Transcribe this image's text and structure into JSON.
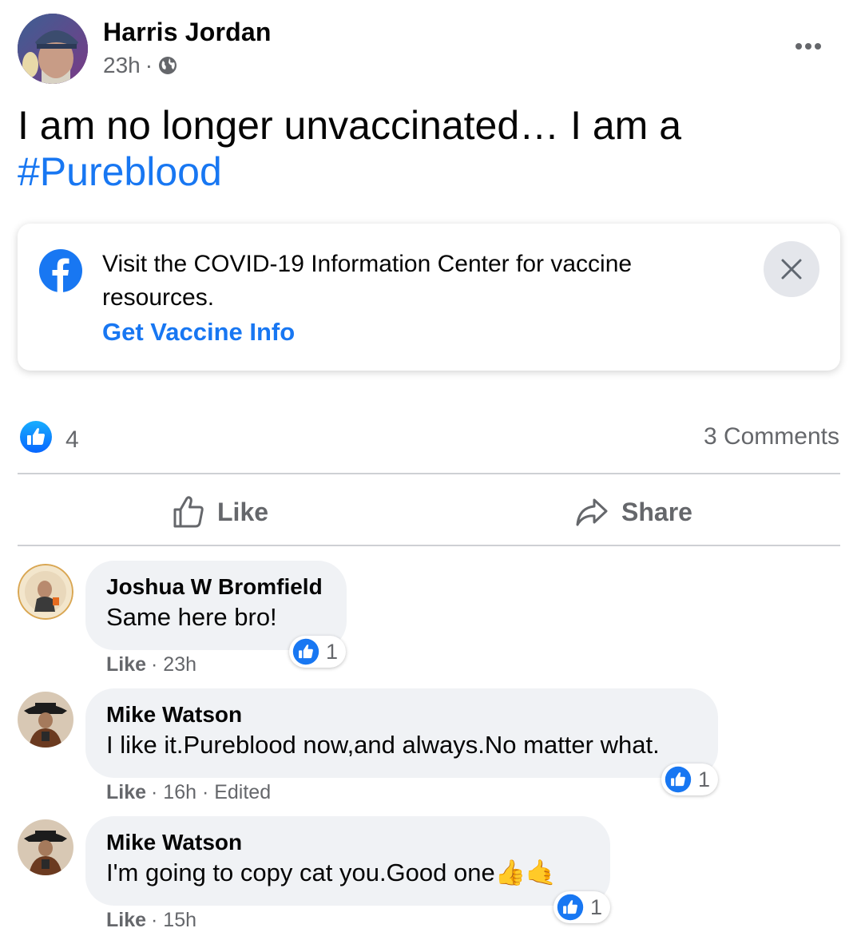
{
  "post": {
    "author": "Harris Jordan",
    "time": "23h",
    "separator": "·",
    "text": "I am no longer unvaccinated… I am a",
    "hashtag": "#Pureblood"
  },
  "info_card": {
    "text": "Visit the COVID-19 Information Center for vaccine resources.",
    "link": "Get Vaccine Info"
  },
  "summary": {
    "reaction_count": "4",
    "comments": "3 Comments"
  },
  "actions": {
    "like": "Like",
    "share": "Share"
  },
  "comments": [
    {
      "name": "Joshua W Bromfield",
      "text": "Same here bro!",
      "reactions": "1",
      "like": "Like",
      "meta": "· 23h"
    },
    {
      "name": "Mike Watson",
      "text": "I like it.Pureblood now,and always.No matter what.",
      "reactions": "1",
      "like": "Like",
      "meta": "· 16h · Edited"
    },
    {
      "name": "Mike Watson",
      "text": "I'm going to copy cat you.Good one",
      "emoji": "👍🤙",
      "reactions": "1",
      "like": "Like",
      "meta": "· 15h"
    }
  ],
  "colors": {
    "accent": "#1877f2",
    "secondary_text": "#65676b",
    "bubble": "#f0f2f5"
  },
  "icons": [
    "globe-icon",
    "more-icon",
    "facebook-logo-icon",
    "close-icon",
    "like-badge-icon",
    "like-outline-icon",
    "share-icon"
  ]
}
